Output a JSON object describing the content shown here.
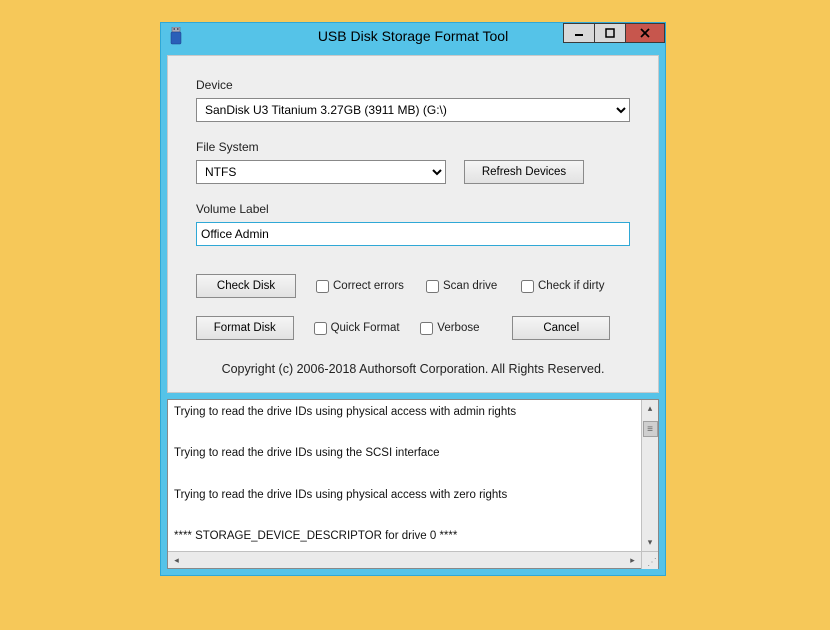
{
  "titlebar": {
    "title": "USB Disk Storage Format Tool"
  },
  "labels": {
    "device": "Device",
    "filesystem": "File System",
    "volume_label": "Volume Label"
  },
  "fields": {
    "device_value": "SanDisk U3 Titanium 3.27GB (3911 MB)  (G:\\)",
    "filesystem_value": "NTFS",
    "volume_value": "Office Admin"
  },
  "buttons": {
    "refresh": "Refresh Devices",
    "check_disk": "Check Disk",
    "format_disk": "Format Disk",
    "cancel": "Cancel"
  },
  "checkboxes": {
    "correct_errors": "Correct errors",
    "scan_drive": "Scan drive",
    "check_if_dirty": "Check if dirty",
    "quick_format": "Quick Format",
    "verbose": "Verbose"
  },
  "copyright": "Copyright (c) 2006-2018 Authorsoft Corporation. All Rights Reserved.",
  "log": {
    "lines": [
      "Trying to read the drive IDs using physical access with admin rights",
      "",
      "",
      "Trying to read the drive IDs using the SCSI interface",
      "",
      "",
      "Trying to read the drive IDs using physical access with zero rights",
      "",
      "",
      "**** STORAGE_DEVICE_DESCRIPTOR for drive 0 ****"
    ]
  }
}
